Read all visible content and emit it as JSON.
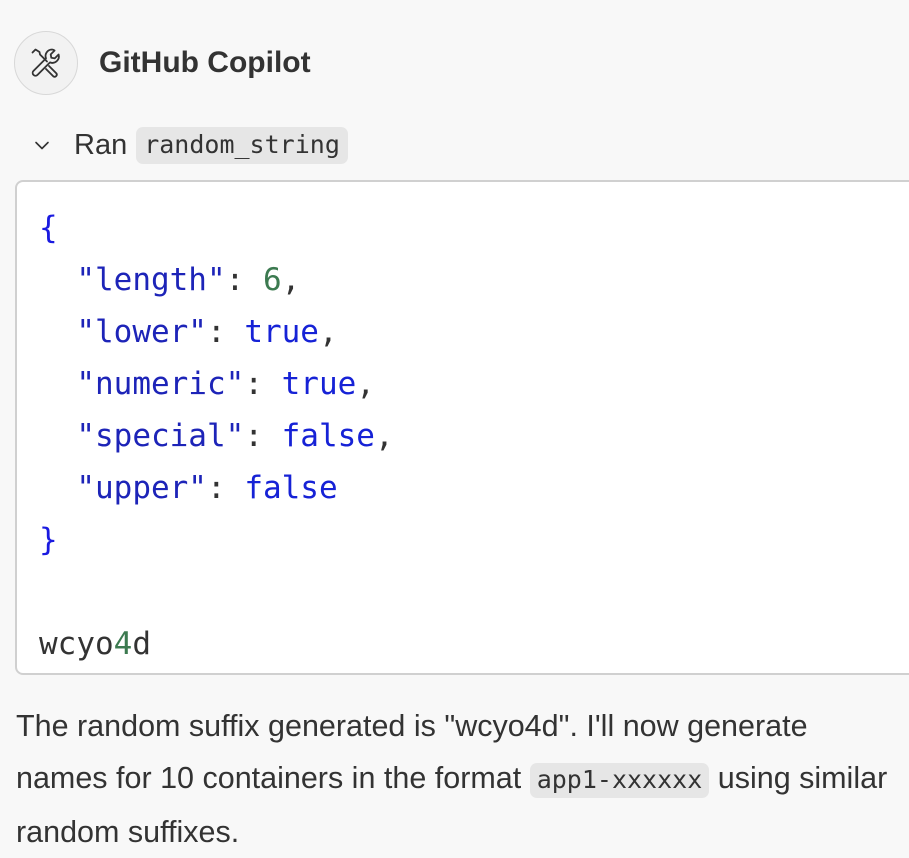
{
  "header": {
    "author": "GitHub Copilot",
    "avatar_icon": "tools-icon"
  },
  "tool_run": {
    "chevron_icon": "chevron-down-icon",
    "label": "Ran",
    "tool_name": "random_string"
  },
  "code": {
    "open_brace": "{",
    "close_brace": "}",
    "params": [
      {
        "key": "\"length\"",
        "value": "6",
        "value_type": "number",
        "trailing": ","
      },
      {
        "key": "\"lower\"",
        "value": "true",
        "value_type": "boolean",
        "trailing": ","
      },
      {
        "key": "\"numeric\"",
        "value": "true",
        "value_type": "boolean",
        "trailing": ","
      },
      {
        "key": "\"special\"",
        "value": "false",
        "value_type": "boolean",
        "trailing": ","
      },
      {
        "key": "\"upper\"",
        "value": "false",
        "value_type": "boolean",
        "trailing": ""
      }
    ],
    "result_prefix": "wcyo",
    "result_digit": "4",
    "result_suffix": "d"
  },
  "message": {
    "text_before": "The random suffix generated is \"wcyo4d\". I'll now generate names for 10 containers in the format ",
    "inline_code": "app1-xxxxxx",
    "text_after": " using similar random suffixes."
  },
  "colors": {
    "background": "#f8f8f8",
    "code_background": "#ffffff",
    "json_key": "#1d24b8",
    "json_number": "#3c7a50",
    "json_boolean": "#1622d6"
  }
}
